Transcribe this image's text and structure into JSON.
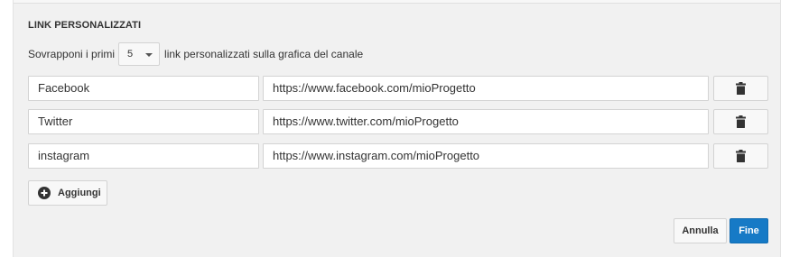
{
  "section": {
    "title": "LINK PERSONALIZZATI"
  },
  "overlay": {
    "prefix": "Sovrapponi i primi",
    "count": "5",
    "suffix": "link personalizzati sulla grafica del canale"
  },
  "links": [
    {
      "title": "Facebook",
      "url": "https://www.facebook.com/mioProgetto"
    },
    {
      "title": "Twitter",
      "url": "https://www.twitter.com/mioProgetto"
    },
    {
      "title": "instagram",
      "url": "https://www.instagram.com/mioProgetto"
    }
  ],
  "actions": {
    "add_label": "Aggiungi",
    "cancel_label": "Annulla",
    "done_label": "Fine"
  },
  "colors": {
    "primary": "#167ac6",
    "panel_bg": "#f1f1f1"
  },
  "icons": {
    "delete": "trash-icon",
    "add": "plus-circle-icon",
    "dropdown": "caret-down-icon"
  }
}
